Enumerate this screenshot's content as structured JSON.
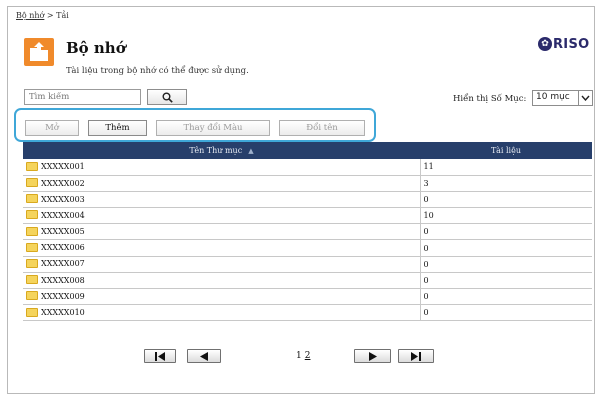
{
  "breadcrumb": {
    "root": "Bộ nhớ",
    "separator": ">",
    "current": "Tải"
  },
  "header": {
    "title": "Bộ nhớ",
    "description": "Tài liệu trong bộ nhớ có thể được sử dụng.",
    "logo_text": "RISO",
    "icon": "folder-upload-icon",
    "accent_color": "#f08a2b"
  },
  "search": {
    "placeholder": "Tìm kiếm",
    "button_icon": "search-icon"
  },
  "display_count": {
    "label": "Hiển thị Số Mục:",
    "selected": "10 mục"
  },
  "toolbar": {
    "highlight_color": "#3fa7d8",
    "buttons": [
      {
        "label": "Mở",
        "enabled": false
      },
      {
        "label": "Thêm",
        "enabled": true
      },
      {
        "label": "Thay đổi Màu",
        "enabled": false
      },
      {
        "label": "Đổi tên",
        "enabled": false
      }
    ]
  },
  "table": {
    "header_color": "#273f6b",
    "columns": [
      "Tên Thư mục",
      "Tài liệu"
    ],
    "rows": [
      {
        "name": "XXXXX001",
        "count": "11"
      },
      {
        "name": "XXXXX002",
        "count": "3"
      },
      {
        "name": "XXXXX003",
        "count": "0"
      },
      {
        "name": "XXXXX004",
        "count": "10"
      },
      {
        "name": "XXXXX005",
        "count": "0"
      },
      {
        "name": "XXXXX006",
        "count": "0"
      },
      {
        "name": "XXXXX007",
        "count": "0"
      },
      {
        "name": "XXXXX008",
        "count": "0"
      },
      {
        "name": "XXXXX009",
        "count": "0"
      },
      {
        "name": "XXXXX010",
        "count": "0"
      }
    ]
  },
  "pager": {
    "current_page": "1",
    "other_page": "2"
  }
}
